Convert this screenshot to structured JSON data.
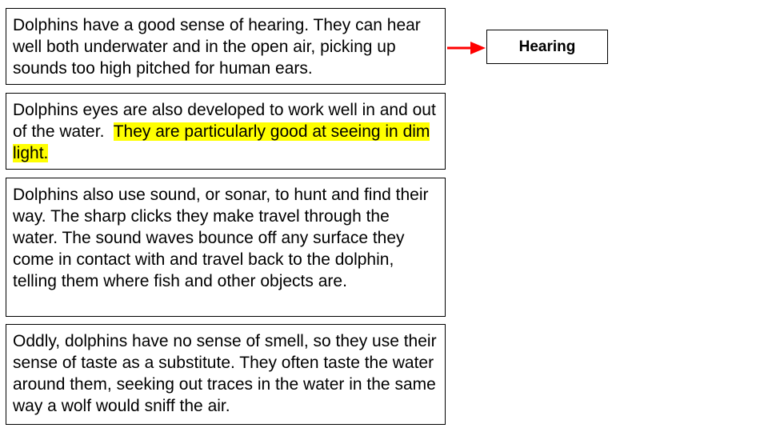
{
  "paragraphs": [
    {
      "text": "Dolphins have a good sense of hearing.  They can hear well both underwater and in the open air, picking up sounds too high pitched for human ears."
    },
    {
      "text": "Dolphins eyes are also developed to work well in and out of the water.  ",
      "highlighted_text": "They are particularly good at seeing in dim light."
    },
    {
      "text": "Dolphins also use sound, or sonar, to hunt and find their way.  The sharp clicks they make travel through the water.  The sound waves bounce off any surface they come in contact with and travel back to the dolphin, telling them where fish and other objects are."
    },
    {
      "text": "Oddly, dolphins have no sense of smell, so they use their sense of taste as a substitute.  They often taste the water around them, seeking out traces in the water in the same way a wolf would sniff the air."
    }
  ],
  "label": "Hearing",
  "arrow_color": "#ff0000",
  "highlight_color": "#ffff00"
}
